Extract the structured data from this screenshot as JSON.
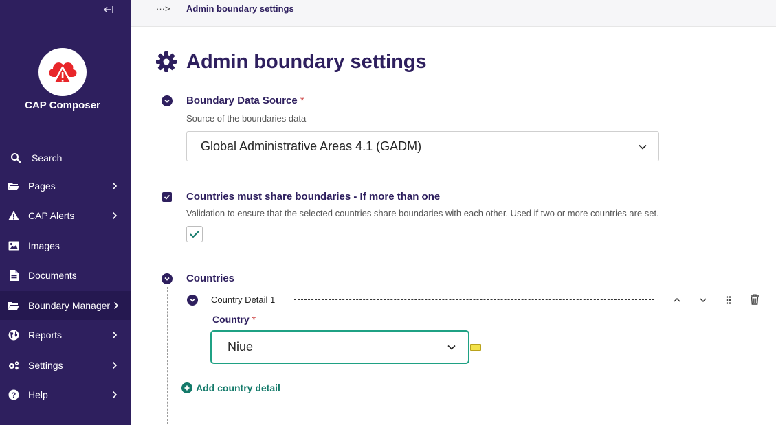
{
  "app": {
    "name": "CAP Composer"
  },
  "breadcrumb": {
    "more": "···>",
    "current": "Admin boundary settings"
  },
  "sidebar": {
    "search": "Search",
    "items": [
      {
        "label": "Pages",
        "icon": "folder-open-icon",
        "has_children": true
      },
      {
        "label": "CAP Alerts",
        "icon": "warning-icon",
        "has_children": true
      },
      {
        "label": "Images",
        "icon": "image-icon",
        "has_children": false
      },
      {
        "label": "Documents",
        "icon": "document-icon",
        "has_children": false
      },
      {
        "label": "Boundary Manager",
        "icon": "folder-open-icon",
        "has_children": true,
        "active": true
      },
      {
        "label": "Reports",
        "icon": "globe-icon",
        "has_children": true
      },
      {
        "label": "Settings",
        "icon": "cogs-icon",
        "has_children": true
      },
      {
        "label": "Help",
        "icon": "help-icon",
        "has_children": true
      }
    ]
  },
  "page": {
    "title": "Admin boundary settings"
  },
  "fields": {
    "boundary_source": {
      "label": "Boundary Data Source",
      "required_mark": "*",
      "help": "Source of the boundaries data",
      "value": "Global Administrative Areas 4.1 (GADM)"
    },
    "share_boundaries": {
      "label": "Countries must share boundaries - If more than one",
      "help": "Validation to ensure that the selected countries share boundaries with each other. Used if two or more countries are set.",
      "checked": true
    },
    "countries": {
      "label": "Countries",
      "detail_title": "Country Detail 1",
      "country_label": "Country",
      "required_mark": "*",
      "country_value": "Niue",
      "add_label": "Add country detail"
    }
  },
  "colors": {
    "sidebar_bg": "#2e1f5e",
    "accent": "#147a6a",
    "focus_border": "#1fa184",
    "logo_red": "#e8262a"
  }
}
